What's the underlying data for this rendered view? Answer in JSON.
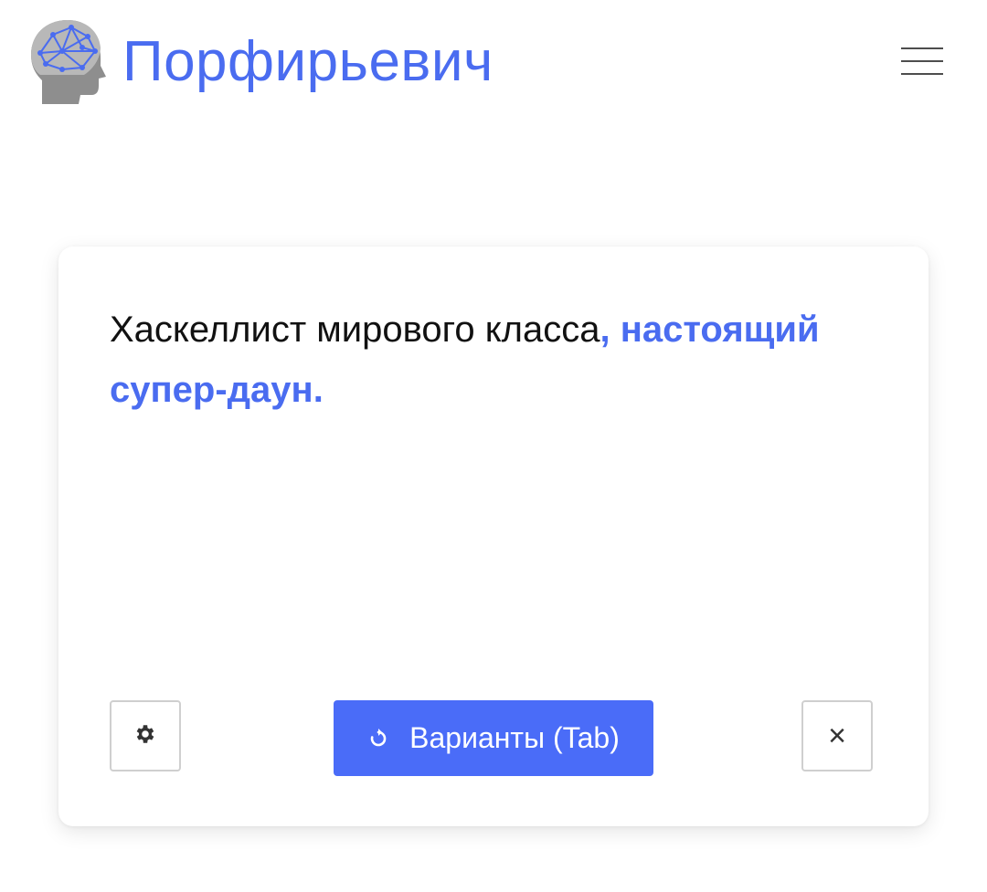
{
  "header": {
    "brand": "Порфирьевич",
    "logo_icon": "brain-head-icon",
    "menu_icon": "hamburger-icon"
  },
  "editor": {
    "user_text": "Хаскеллист мирового класса",
    "generated_text": ", настоящий супер-даун."
  },
  "actions": {
    "settings_icon": "gear-icon",
    "variants_label": "Варианты (Tab)",
    "variants_icon": "refresh-icon",
    "close_icon": "close-icon",
    "close_glyph": "×"
  },
  "colors": {
    "accent": "#4a6cf0",
    "button": "#4a6cf8",
    "text": "#111111",
    "border": "#cfcfcf"
  }
}
